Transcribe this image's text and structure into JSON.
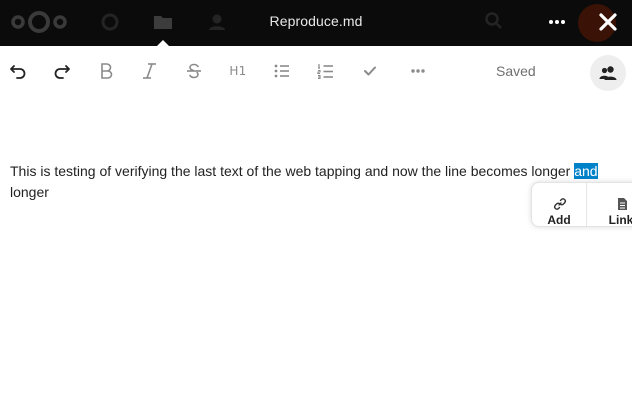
{
  "header": {
    "file_title": "Reproduce.md",
    "more_icon": "three-dots-icon",
    "close_icon": "close-icon",
    "logo": "nextcloud-logo",
    "nav_icons": [
      "dashboard-icon",
      "files-icon",
      "contacts-icon"
    ]
  },
  "toolbar": {
    "buttons": [
      {
        "name": "undo-button",
        "icon": "undo-icon"
      },
      {
        "name": "redo-button",
        "icon": "redo-icon"
      },
      {
        "name": "bold-button",
        "icon": "bold-icon"
      },
      {
        "name": "italic-button",
        "icon": "italic-icon"
      },
      {
        "name": "strikethrough-button",
        "icon": "strikethrough-icon"
      },
      {
        "name": "heading-button",
        "icon": "heading-icon"
      },
      {
        "name": "bullet-list-button",
        "icon": "bullet-list-icon"
      },
      {
        "name": "ordered-list-button",
        "icon": "ordered-list-icon"
      },
      {
        "name": "checklist-button",
        "icon": "check-icon"
      },
      {
        "name": "more-formatting-button",
        "icon": "three-dots-icon"
      }
    ],
    "heading_label": "H1",
    "status": "Saved",
    "sessions_icon": "users-icon"
  },
  "editor": {
    "text_before": "This is testing of verifying the last text of the web tapping and now the line becomes longer ",
    "selected_text": "and",
    "text_after": " longer"
  },
  "link_bubble": {
    "add_label": "Add",
    "add_icon": "link-icon",
    "link_label": "Link",
    "link_icon": "document-icon"
  },
  "colors": {
    "selection": "#0082c9",
    "topbar": "#0b0b0b",
    "toolbar_icons": "#8a8a8a"
  }
}
